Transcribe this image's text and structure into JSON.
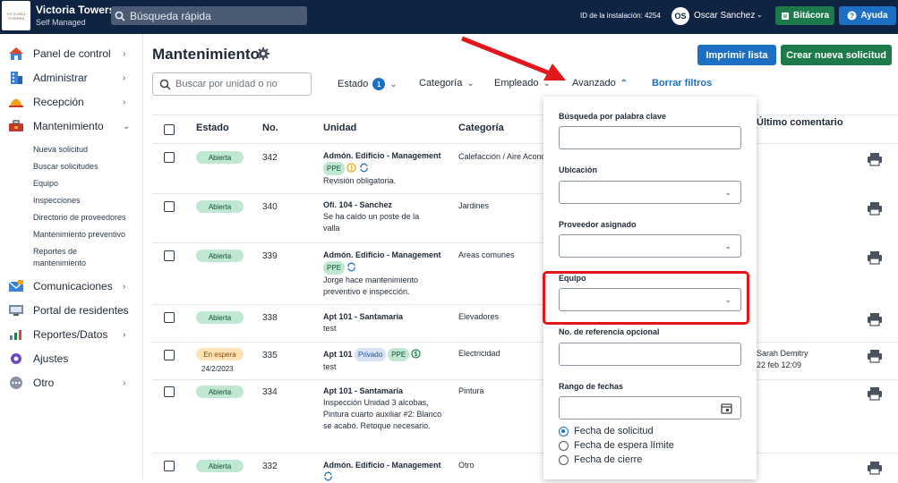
{
  "topbar": {
    "logo_text": "VICTORIA TOWERS",
    "brand_title": "Victoria Towers",
    "brand_subtitle": "Self Managed",
    "quick_search_placeholder": "Búsqueda rápida",
    "installation_id": "ID de la instalación: 4254",
    "user_initials": "OS",
    "user_name": "Oscar Sanchez",
    "bitacora_label": "Bitácora",
    "ayuda_label": "Ayuda"
  },
  "sidebar": {
    "items": [
      {
        "label": "Panel de control",
        "icon": "dashboard-icon"
      },
      {
        "label": "Administrar",
        "icon": "building-icon"
      },
      {
        "label": "Recepción",
        "icon": "bell-icon"
      },
      {
        "label": "Mantenimiento",
        "icon": "toolbox-icon"
      },
      {
        "label": "Comunicaciones",
        "icon": "mail-icon"
      },
      {
        "label": "Portal de residentes",
        "icon": "portal-icon"
      },
      {
        "label": "Reportes/Datos",
        "icon": "chart-icon"
      },
      {
        "label": "Ajustes",
        "icon": "gear-icon"
      },
      {
        "label": "Otro",
        "icon": "more-icon"
      }
    ],
    "subitems": [
      "Nueva solicitud",
      "Buscar solicitudes",
      "Equipo",
      "Inspecciones",
      "Directorio de proveedores",
      "Mantenimiento preventivo",
      "Reportes de mantenimiento"
    ]
  },
  "main": {
    "title": "Mantenimiento",
    "print_button": "Imprimir lista",
    "new_button": "Crear nueva solicitud",
    "search_placeholder": "Buscar por unidad o no",
    "filters": {
      "estado": "Estado",
      "estado_count": "1",
      "categoria": "Categoría",
      "empleado": "Empleado",
      "avanzado": "Avanzado",
      "clear": "Borrar filtros"
    },
    "columns": {
      "estado": "Estado",
      "no": "No.",
      "unidad": "Unidad",
      "categoria": "Categoría",
      "ultimo": "Último comentario"
    },
    "rows": [
      {
        "status": "Abierta",
        "no": "342",
        "unit": "Admón. Edificio - Management",
        "desc": "Revisión obligatoria.",
        "cat": "Calefacción / Aire Acondicionado",
        "ppe": "PPE"
      },
      {
        "status": "Abierta",
        "no": "340",
        "unit": "Ofi. 104 - Sanchez",
        "desc": "Se ha caído un poste de la valla",
        "cat": "Jardines"
      },
      {
        "status": "Abierta",
        "no": "339",
        "unit": "Admón. Edificio - Management",
        "desc": "Jorge hace mantenimiento preventivo e inspección.",
        "cat": "Areas comunes",
        "ppe": "PPE"
      },
      {
        "status": "Abierta",
        "no": "338",
        "unit": "Apt 101 - Santamaría",
        "desc": "test",
        "cat": "Elevadores"
      },
      {
        "status": "En espera",
        "date": "24/2/2023",
        "no": "335",
        "unit": "Apt 101",
        "desc": "test",
        "cat": "Electricidad",
        "priv": "Privado",
        "ppe": "PPE",
        "comment_name": "Sarah Demitry",
        "comment_date": "22 feb 12:09"
      },
      {
        "status": "Abierta",
        "no": "334",
        "unit": "Apt 101 - Santamaría",
        "desc": "Inspección Unidad 3 alcobas, Pintura cuarto auxiliar #2: Blanco se acabó. Retoque necesario.",
        "cat": "Pintura"
      },
      {
        "status": "Abierta",
        "no": "332",
        "unit": "Admón. Edificio - Management",
        "desc": "",
        "cat": "Otro"
      }
    ]
  },
  "advanced_panel": {
    "keyword_label": "Búsqueda por palabra clave",
    "location_label": "Ubicación",
    "vendor_label": "Proveedor asignado",
    "equipment_label": "Equipo",
    "reference_label": "No. de referencia opcional",
    "date_range_label": "Rango de fechas",
    "radio_options": [
      "Fecha de solicitud",
      "Fecha de espera límite",
      "Fecha de cierre"
    ]
  },
  "colors": {
    "topbar": "#0f2342",
    "primary": "#1d6fc4",
    "success": "#1d7a4a",
    "annotation": "#e0181b"
  }
}
